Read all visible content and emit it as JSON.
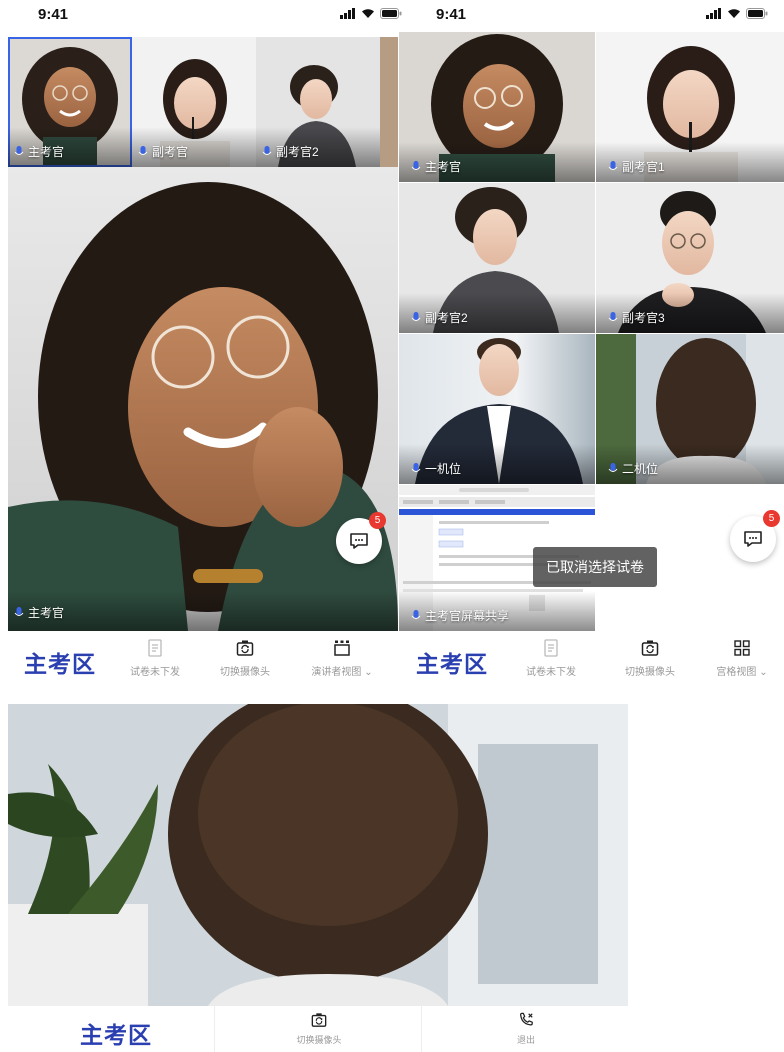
{
  "status_bar": {
    "time": "9:41"
  },
  "participants": {
    "chief": "主考官",
    "deputy": "副考官",
    "deputy1": "副考官1",
    "deputy2": "副考官2",
    "deputy3": "副考官3",
    "camera1": "一机位",
    "camera2": "二机位",
    "screen_share": "主考官屏幕共享"
  },
  "chat": {
    "unread": "5"
  },
  "toast": "已取消选择试卷",
  "toolbar": {
    "brand": "主考区",
    "paper_not_sent": "试卷未下发",
    "switch_camera": "切换摄像头",
    "speaker_view": "演讲者视图",
    "grid_view": "宫格视图",
    "exit": "退出"
  },
  "colors": {
    "brand": "#2a3fb0",
    "accent": "#3a64e6",
    "badge": "#e8382f"
  }
}
